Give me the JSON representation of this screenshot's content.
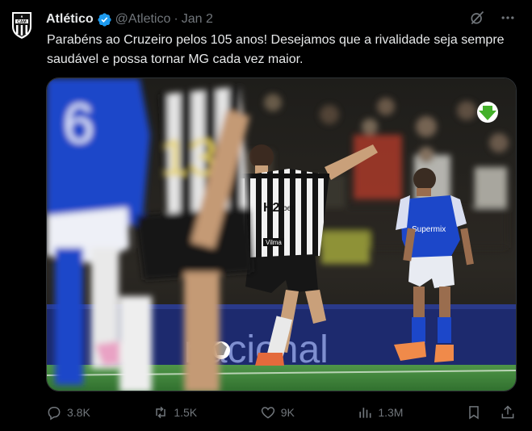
{
  "tweet": {
    "author_name": "Atlético",
    "handle": "@Atletico",
    "separator": "·",
    "date": "Jan 2",
    "text": "Parabéns ao Cruzeiro pelos 105 anos! Desejamos que a rivalidade seja sempre saudável e possa tornar MG cada vez maior.",
    "logo_text": "CAM"
  },
  "media": {
    "jersey_back_number": "13",
    "sponsor_h2": "H2",
    "sponsor_bet": "bet",
    "sponsor_vilma": "Vilma",
    "cruzeiro_sponsor": "Supermix",
    "ad_board_text": "nacional",
    "download_icon": "arrow-down-icon"
  },
  "stats": {
    "replies": "3.8K",
    "reposts": "1.5K",
    "likes": "9K",
    "views": "1.3M"
  },
  "colors": {
    "background": "#000000",
    "text": "#e7e9ea",
    "muted": "#71767b",
    "verified": "#1d9bf0",
    "cruzeiro_blue": "#1c47c9",
    "pitch_green": "#3f8a3c"
  }
}
